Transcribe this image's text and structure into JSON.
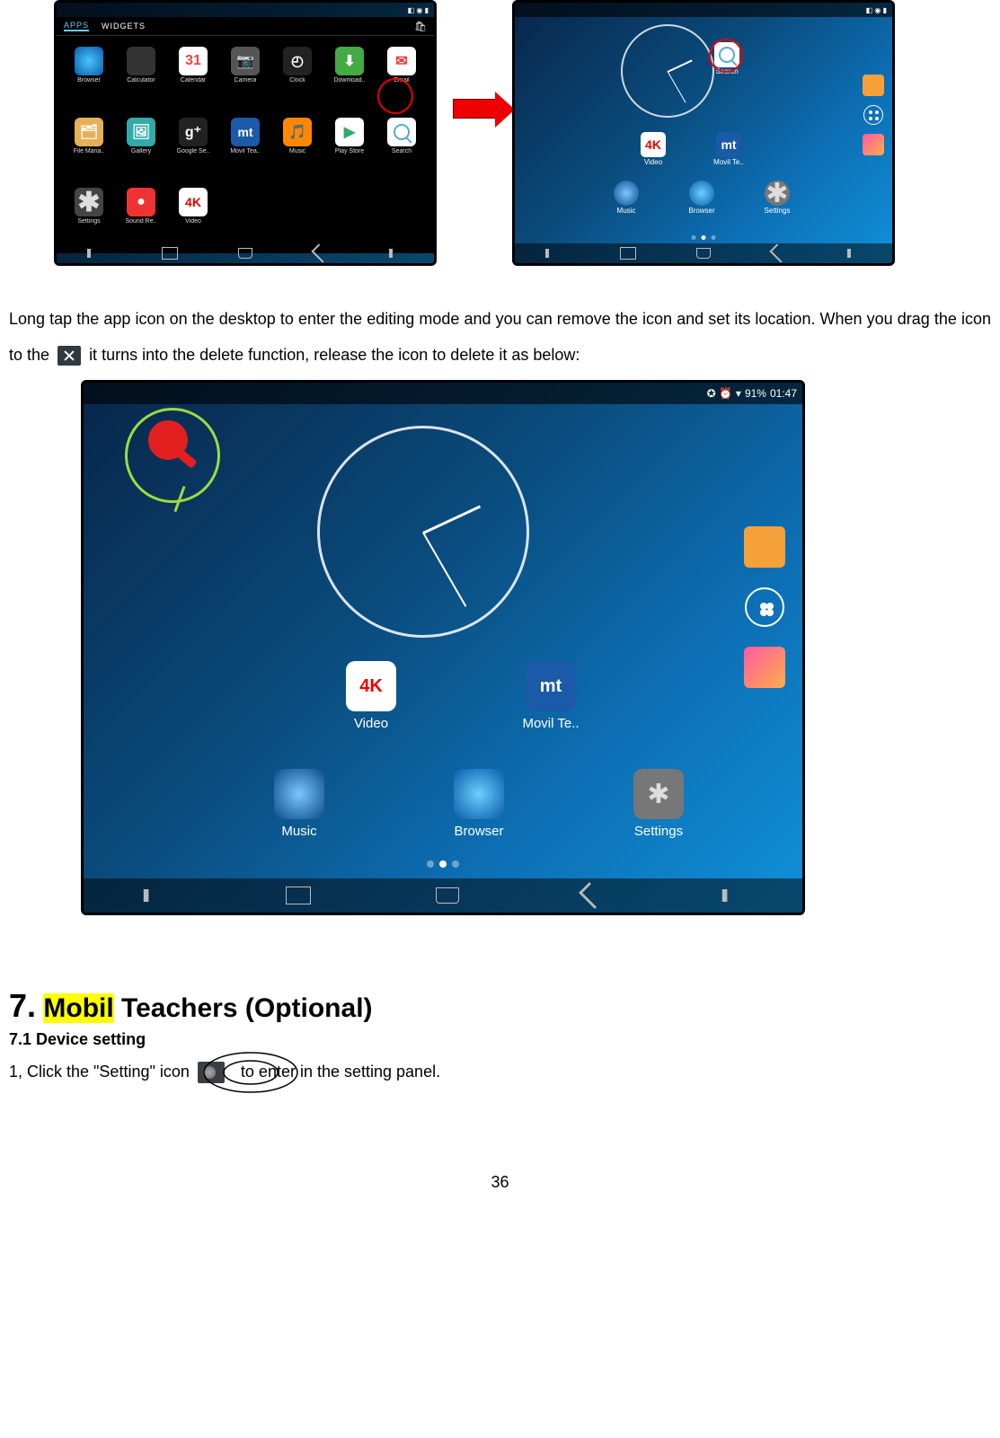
{
  "status": {
    "signal_icon": "wifi",
    "battery_text": "91%",
    "time": "01:47"
  },
  "apps_drawer": {
    "tabs": {
      "apps": "APPS",
      "widgets": "WIDGETS"
    },
    "items": [
      {
        "label": "Browser",
        "icon": "browser"
      },
      {
        "label": "Calculator",
        "icon": "calc"
      },
      {
        "label": "Calendar",
        "icon": "cal"
      },
      {
        "label": "Camera",
        "icon": "cam"
      },
      {
        "label": "Clock",
        "icon": "clock"
      },
      {
        "label": "Download..",
        "icon": "down"
      },
      {
        "label": "Email",
        "icon": "mail"
      },
      {
        "label": "File Mana..",
        "icon": "file"
      },
      {
        "label": "Gallery",
        "icon": "gallery"
      },
      {
        "label": "Google Se..",
        "icon": "gsearch"
      },
      {
        "label": "Movil Tea..",
        "icon": "movil"
      },
      {
        "label": "Music",
        "icon": "music"
      },
      {
        "label": "Play Store",
        "icon": "play"
      },
      {
        "label": "Search",
        "icon": "search"
      },
      {
        "label": "Settings",
        "icon": "settings"
      },
      {
        "label": "Sound Re..",
        "icon": "sound"
      },
      {
        "label": "Video",
        "icon": "video"
      }
    ]
  },
  "home_small": {
    "row1": [
      {
        "label": "Video",
        "icon": "video"
      },
      {
        "label": "Movil Te..",
        "icon": "movil"
      }
    ],
    "row2": [
      {
        "label": "Music",
        "icon": "music"
      },
      {
        "label": "Browser",
        "icon": "browser"
      },
      {
        "label": "Settings",
        "icon": "settings"
      }
    ],
    "dragged": {
      "label": "Search",
      "icon": "search"
    }
  },
  "home_large": {
    "row1": [
      {
        "label": "Video",
        "icon": "video"
      },
      {
        "label": "Movil Te..",
        "icon": "movil"
      }
    ],
    "row2": [
      {
        "label": "Music",
        "icon": "music"
      },
      {
        "label": "Browser",
        "icon": "browser"
      },
      {
        "label": "Settings",
        "icon": "settings"
      }
    ]
  },
  "text": {
    "para_before": "Long tap the app icon on the desktop to enter the editing mode and you can remove the icon and set its location. When you drag the icon to the ",
    "para_after": " it turns into the delete function, release the icon to delete it as below:",
    "section_num": "7.",
    "section_hl": "Mobil",
    "section_rest": " Teachers (Optional)",
    "sub71": "7.1 Device setting",
    "line71_a": "1, Click the \"Setting\" icon",
    "line71_b": "to enter in the setting panel.",
    "page_number": "36"
  }
}
